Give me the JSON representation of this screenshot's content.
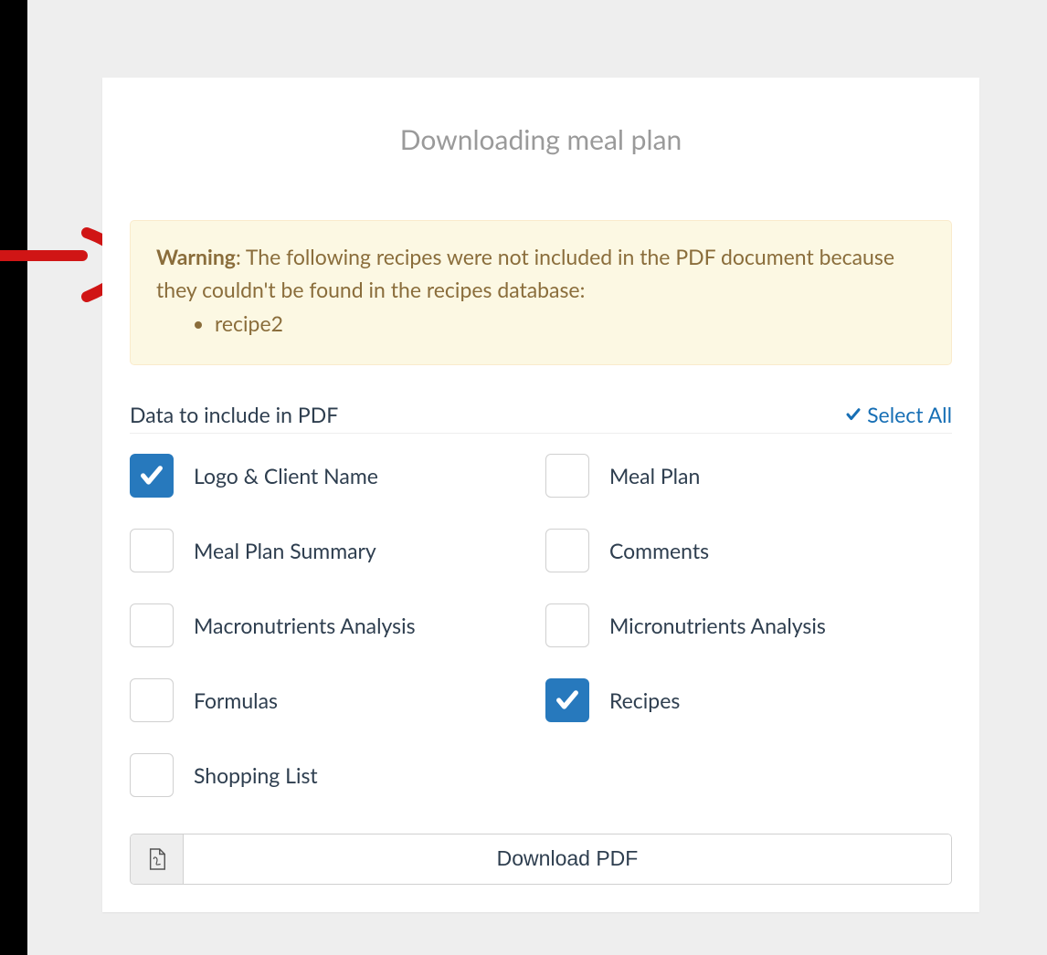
{
  "title": "Downloading meal plan",
  "alert": {
    "label": "Warning",
    "message": ": The following recipes were not included in the PDF document because they couldn't be found in the recipes database:",
    "items": [
      "recipe2"
    ]
  },
  "section": {
    "label": "Data to include in PDF",
    "selectAll": "Select All"
  },
  "options": [
    {
      "label": "Logo & Client Name",
      "checked": true
    },
    {
      "label": "Meal Plan",
      "checked": false
    },
    {
      "label": "Meal Plan Summary",
      "checked": false
    },
    {
      "label": "Comments",
      "checked": false
    },
    {
      "label": "Macronutrients Analysis",
      "checked": false
    },
    {
      "label": "Micronutrients Analysis",
      "checked": false
    },
    {
      "label": "Formulas",
      "checked": false
    },
    {
      "label": "Recipes",
      "checked": true
    },
    {
      "label": "Shopping List",
      "checked": false
    }
  ],
  "download": {
    "label": "Download PDF"
  }
}
